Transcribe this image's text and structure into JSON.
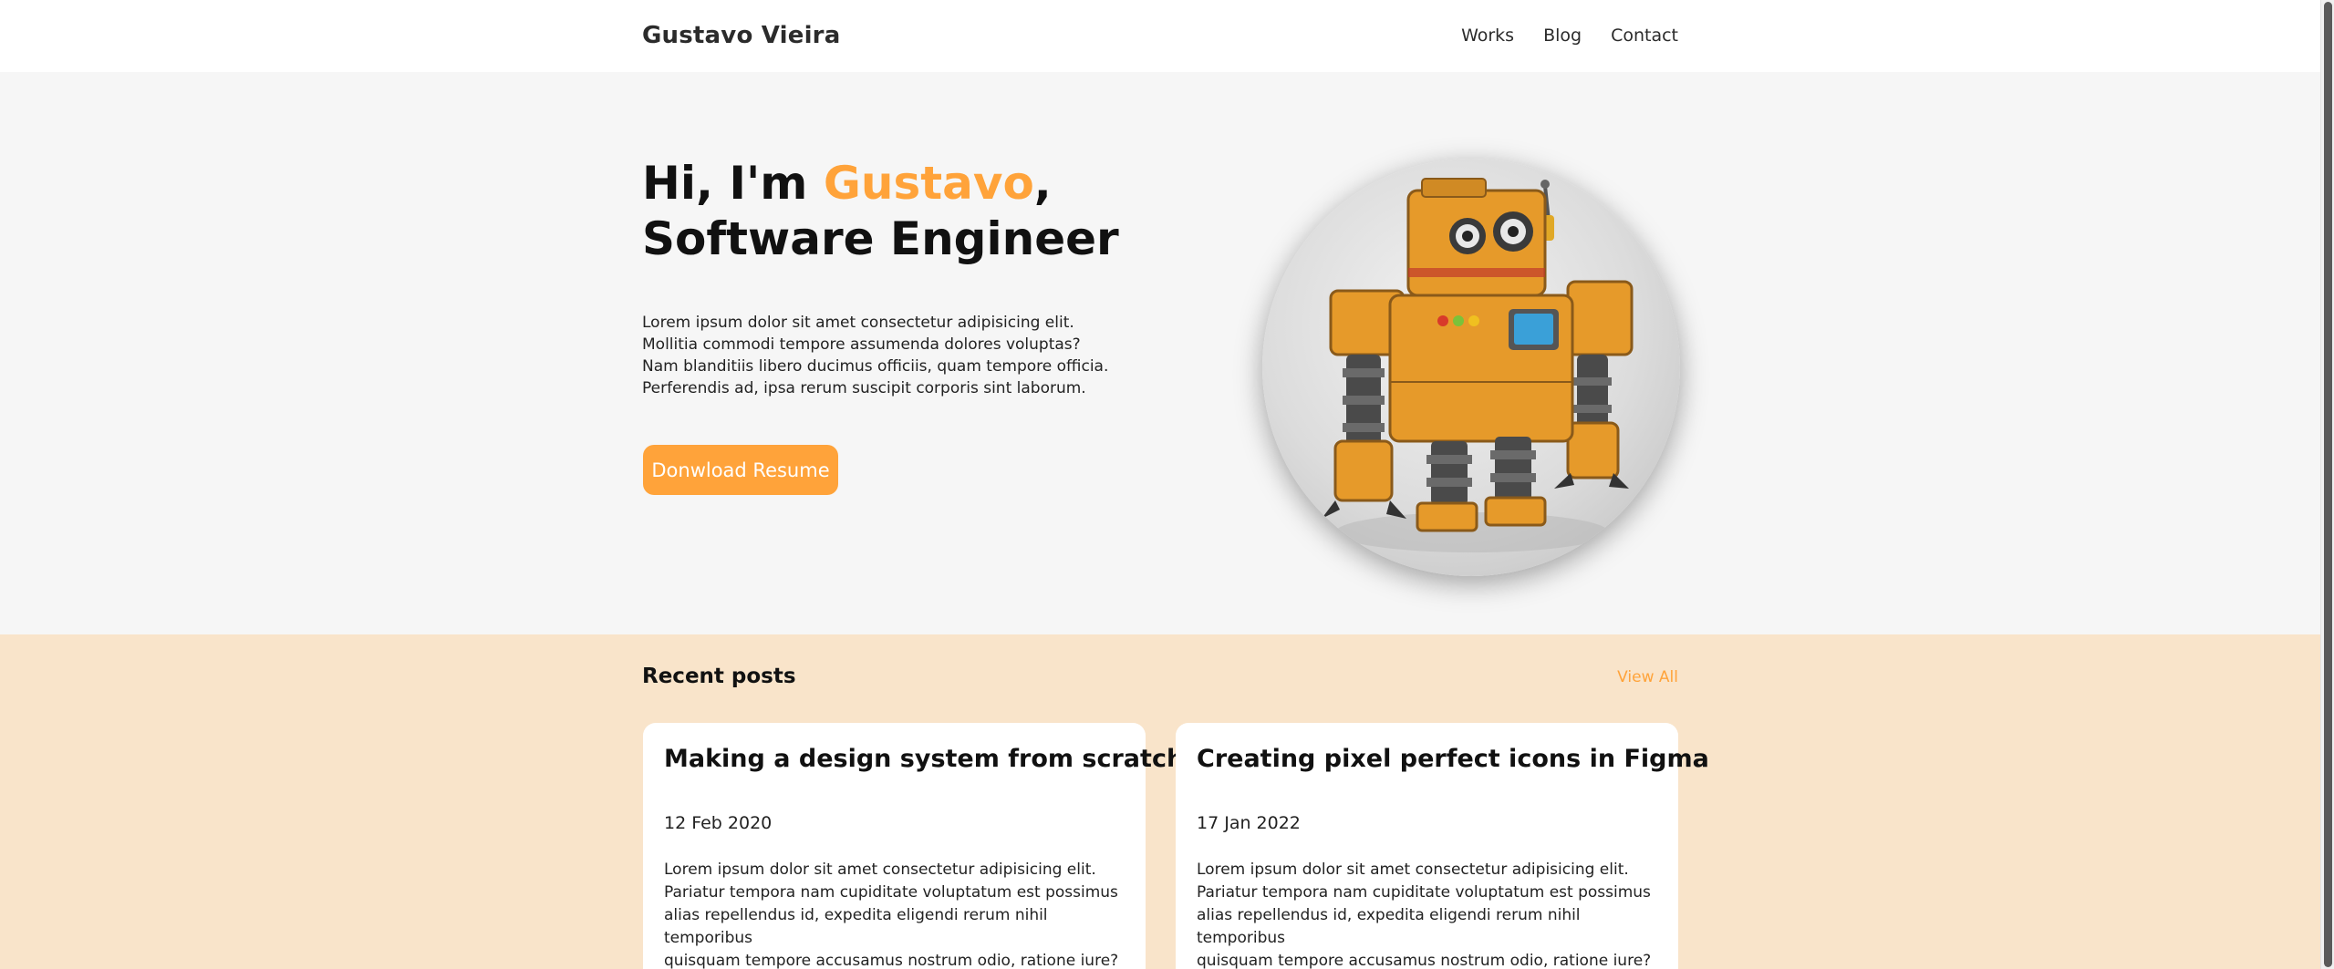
{
  "header": {
    "brand": "Gustavo Vieira",
    "nav": [
      "Works",
      "Blog",
      "Contact"
    ]
  },
  "hero": {
    "greeting": "Hi, I'm ",
    "name": "Gustavo",
    "comma": ",",
    "role": "Software Engineer",
    "description": [
      "Lorem ipsum dolor sit amet consectetur adipisicing elit.",
      "Mollitia commodi tempore assumenda dolores voluptas?",
      "Nam blanditiis libero ducimus officiis, quam tempore officia.",
      "Perferendis ad, ipsa rerum suscipit corporis sint laborum."
    ],
    "button_label": "Donwload Resume"
  },
  "posts": {
    "title": "Recent posts",
    "view_all": "View All",
    "items": [
      {
        "title": "Making a design system from scratch",
        "date": "12 Feb 2020",
        "excerpt": [
          "Lorem ipsum dolor sit amet consectetur adipisicing elit.",
          "Pariatur tempora nam cupiditate voluptatum est possimus",
          "alias repellendus id, expedita eligendi rerum nihil temporibus",
          "quisquam tempore accusamus nostrum odio, ratione iure?"
        ]
      },
      {
        "title": "Creating pixel perfect icons in Figma",
        "date": "17 Jan 2022",
        "excerpt": [
          "Lorem ipsum dolor sit amet consectetur adipisicing elit.",
          "Pariatur tempora nam cupiditate voluptatum est possimus",
          "alias repellendus id, expedita eligendi rerum nihil temporibus",
          "quisquam tempore accusamus nostrum odio, ratione iure?"
        ]
      }
    ]
  },
  "colors": {
    "accent": "#ffa33a",
    "hero_bg": "#f6f6f6",
    "posts_bg": "#f9e4ca"
  },
  "icons": {
    "avatar": "robot-illustration"
  }
}
